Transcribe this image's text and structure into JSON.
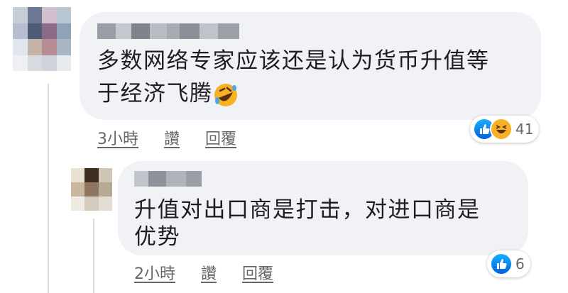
{
  "comment1": {
    "text_line1": "多数网络专家应该还是认为货币升值等",
    "text_line2": "于经济飞腾",
    "emoji": "rolling-on-floor-laughing-emoji",
    "time": "3小時",
    "like": "讚",
    "reply": "回覆",
    "reaction_count": "41",
    "reactions": [
      "like",
      "haha"
    ]
  },
  "comment2": {
    "text_line1": "升值对出口商是打击，对进口商是",
    "text_line2": "优势",
    "time": "2小時",
    "like": "讚",
    "reply": "回覆",
    "reaction_count": "6",
    "reactions": [
      "like"
    ]
  },
  "colors": {
    "bubble": "#f0f2f5",
    "meta": "#65676b",
    "like_blue": "#1877f2",
    "haha_yellow": "#f7b125"
  }
}
